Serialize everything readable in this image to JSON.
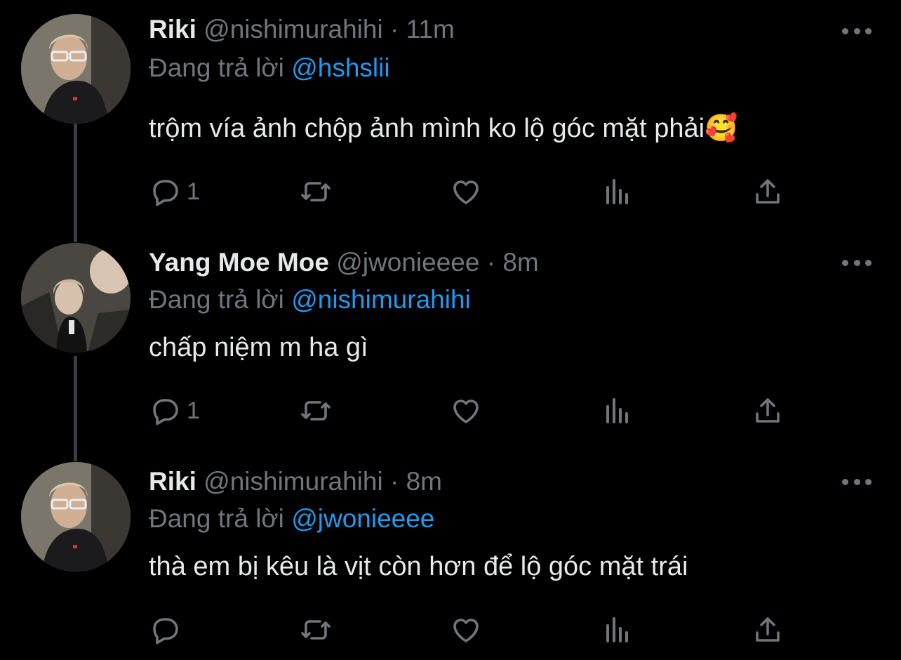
{
  "reply_prefix": "Đang trả lời",
  "tweets": [
    {
      "name": "Riki",
      "handle": "@nishimurahihi",
      "sep": "·",
      "time": "11m",
      "reply_to": "@hshslii",
      "text": "trộm vía ảnh chộp ảnh mình ko lộ góc mặt phải🥰",
      "reply_count": "1"
    },
    {
      "name": "Yang Moe Moe",
      "handle": "@jwonieeee",
      "sep": "·",
      "time": "8m",
      "reply_to": "@nishimurahihi",
      "text": "chấp niệm m ha gì",
      "reply_count": "1"
    },
    {
      "name": "Riki",
      "handle": "@nishimurahihi",
      "sep": "·",
      "time": "8m",
      "reply_to": "@jwonieeee",
      "text": "thà em bị kêu là vịt còn hơn để lộ góc mặt trái",
      "reply_count": ""
    }
  ],
  "icons": [
    "reply-icon",
    "retweet-icon",
    "like-icon",
    "views-icon",
    "share-icon",
    "more-icon"
  ],
  "colors": {
    "background": "#000000",
    "text": "#e7e9ea",
    "muted": "#71767b",
    "link": "#1d9bf0"
  }
}
